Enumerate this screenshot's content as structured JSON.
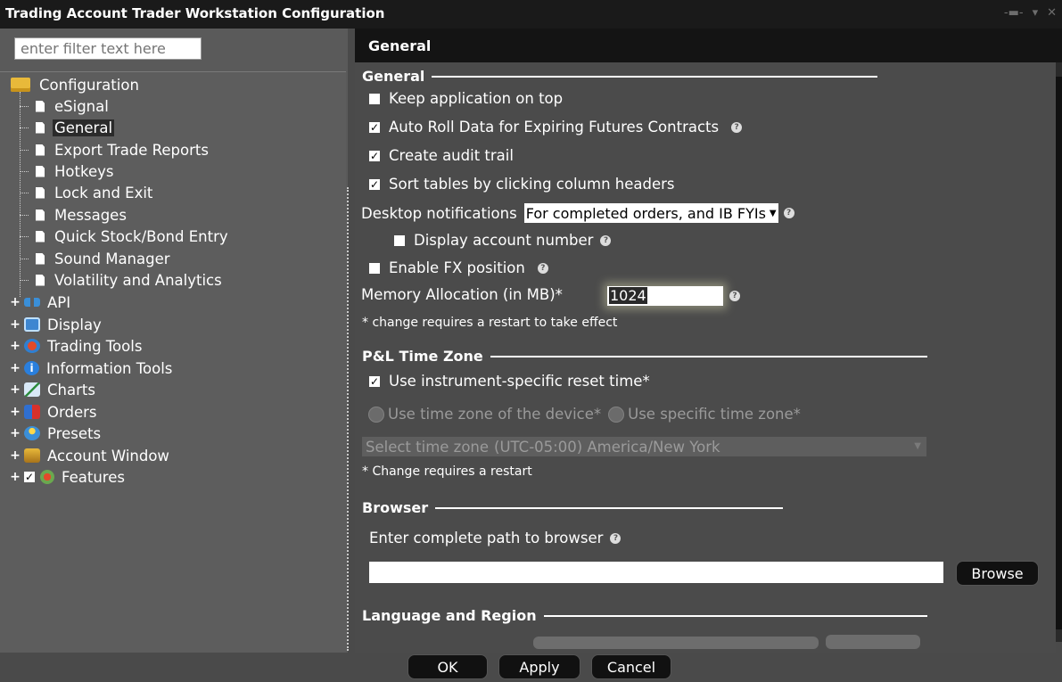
{
  "window": {
    "title": "Trading Account Trader Workstation Configuration",
    "controls": [
      "-▬-",
      "▾",
      "✕"
    ]
  },
  "filter": {
    "placeholder": "enter filter text here"
  },
  "tree": {
    "root": "Configuration",
    "children": [
      "eSignal",
      "General",
      "Export Trade Reports",
      "Hotkeys",
      "Lock and Exit",
      "Messages",
      "Quick Stock/Bond Entry",
      "Sound Manager",
      "Volatility and Analytics"
    ],
    "groups": [
      "API",
      "Display",
      "Trading Tools",
      "Information Tools",
      "Charts",
      "Orders",
      "Presets",
      "Account Window",
      "Features"
    ],
    "selected": "General"
  },
  "panel": {
    "header": "General"
  },
  "general": {
    "section": "General",
    "keep_on_top": "Keep application on top",
    "auto_roll": "Auto Roll Data for Expiring Futures Contracts",
    "audit_trail": "Create audit trail",
    "sort_tables": "Sort tables by clicking column headers",
    "desktop_notifications_label": "Desktop notifications",
    "desktop_notifications_value": "For completed orders, and IB FYIs",
    "display_account": "Display account number",
    "enable_fx": "Enable FX position",
    "memory_label": "Memory Allocation (in MB)*",
    "memory_value": "1024",
    "restart_note": "* change requires a restart to take effect"
  },
  "pl": {
    "section": "P&L Time Zone",
    "instrument_reset": "Use instrument-specific reset time*",
    "device_tz": "Use time zone of the device*",
    "specific_tz": "Use specific time zone*",
    "select_label": "Select time zone",
    "select_value": "(UTC-05:00) America/New York",
    "note": "* Change requires a restart"
  },
  "browser": {
    "section": "Browser",
    "path_label": "Enter complete path to browser",
    "path_value": "",
    "browse": "Browse"
  },
  "language": {
    "section": "Language and Region"
  },
  "footer": {
    "ok": "OK",
    "apply": "Apply",
    "cancel": "Cancel"
  },
  "checks": {
    "mark": "✓",
    "help": "?"
  }
}
